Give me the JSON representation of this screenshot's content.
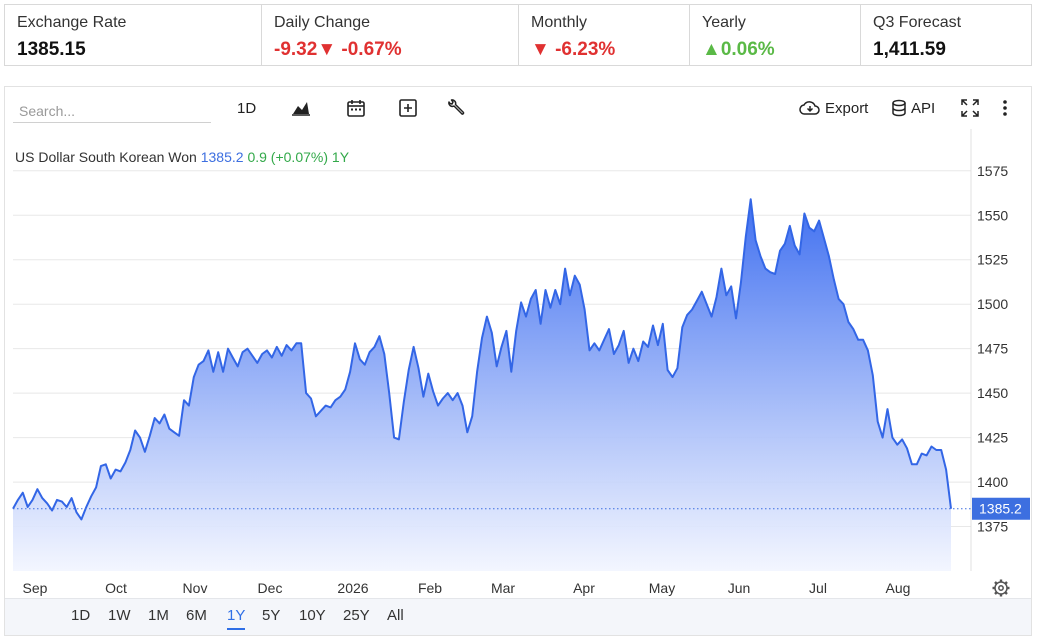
{
  "stats": [
    {
      "label": "Exchange Rate",
      "value": "1385.15",
      "tone": "black",
      "arrow": ""
    },
    {
      "label": "Daily Change",
      "value": "-9.32",
      "arrow": "▼",
      "value2": "-0.67%",
      "tone": "neg"
    },
    {
      "label": "Monthly",
      "value": "-6.23%",
      "arrow": "▼",
      "tone": "neg"
    },
    {
      "label": "Yearly",
      "value": "0.06%",
      "arrow": "▲",
      "tone": "pos"
    },
    {
      "label": "Q3 Forecast",
      "value": "1,411.59",
      "tone": "black",
      "arrow": ""
    }
  ],
  "toolbar": {
    "search_placeholder": "Search...",
    "interval": "1D",
    "export_label": "Export",
    "api_label": "API"
  },
  "legend": {
    "name": "US Dollar South Korean Won",
    "last": "1385.2",
    "change": "0.9 (+0.07%)",
    "range": "1Y"
  },
  "ranges": [
    "1D",
    "1W",
    "1M",
    "6M",
    "1Y",
    "5Y",
    "10Y",
    "25Y",
    "All"
  ],
  "active_range": "1Y",
  "colors": {
    "line": "#3366e6",
    "fill_top": "#3f6ff0",
    "fill_bottom": "#f2f5ff",
    "grid": "#e8e8e8",
    "badge": "#3d6fe0"
  },
  "chart_data": {
    "type": "area",
    "x_labels": [
      "Sep",
      "Oct",
      "Nov",
      "Dec",
      "2026",
      "Feb",
      "Mar",
      "Apr",
      "May",
      "Jun",
      "Jul",
      "Aug"
    ],
    "y_ticks": [
      1375,
      1400,
      1425,
      1450,
      1475,
      1500,
      1525,
      1550,
      1575
    ],
    "ylim": [
      1350,
      1585
    ],
    "last_value_label": "1385.2",
    "values": [
      1385,
      1390,
      1394,
      1386,
      1390,
      1396,
      1391,
      1388,
      1384,
      1390,
      1389,
      1386,
      1391,
      1383,
      1379,
      1386,
      1392,
      1397,
      1409,
      1410,
      1402,
      1407,
      1406,
      1411,
      1418,
      1429,
      1425,
      1417,
      1426,
      1436,
      1433,
      1438,
      1430,
      1428,
      1426,
      1446,
      1443,
      1459,
      1466,
      1468,
      1474,
      1462,
      1473,
      1462,
      1475,
      1470,
      1465,
      1473,
      1475,
      1471,
      1467,
      1472,
      1474,
      1470,
      1476,
      1471,
      1477,
      1474,
      1478,
      1478,
      1450,
      1447,
      1437,
      1440,
      1443,
      1442,
      1446,
      1448,
      1452,
      1462,
      1478,
      1469,
      1466,
      1473,
      1476,
      1482,
      1472,
      1450,
      1425,
      1424,
      1445,
      1463,
      1476,
      1464,
      1448,
      1461,
      1451,
      1443,
      1447,
      1450,
      1446,
      1450,
      1443,
      1428,
      1437,
      1462,
      1481,
      1493,
      1484,
      1465,
      1476,
      1485,
      1462,
      1485,
      1501,
      1493,
      1503,
      1508,
      1489,
      1508,
      1498,
      1508,
      1500,
      1520,
      1505,
      1516,
      1511,
      1497,
      1474,
      1478,
      1474,
      1480,
      1486,
      1472,
      1477,
      1485,
      1467,
      1475,
      1468,
      1479,
      1476,
      1488,
      1477,
      1489,
      1463,
      1459,
      1464,
      1487,
      1494,
      1497,
      1502,
      1507,
      1500,
      1493,
      1504,
      1520,
      1505,
      1510,
      1492,
      1512,
      1538,
      1559,
      1536,
      1527,
      1520,
      1518,
      1517,
      1530,
      1534,
      1544,
      1533,
      1528,
      1551,
      1543,
      1541,
      1547,
      1537,
      1527,
      1514,
      1503,
      1500,
      1490,
      1486,
      1480,
      1480,
      1474,
      1460,
      1434,
      1425,
      1441,
      1425,
      1421,
      1424,
      1419,
      1410,
      1410,
      1416,
      1415,
      1420,
      1418,
      1418,
      1407,
      1385
    ]
  }
}
